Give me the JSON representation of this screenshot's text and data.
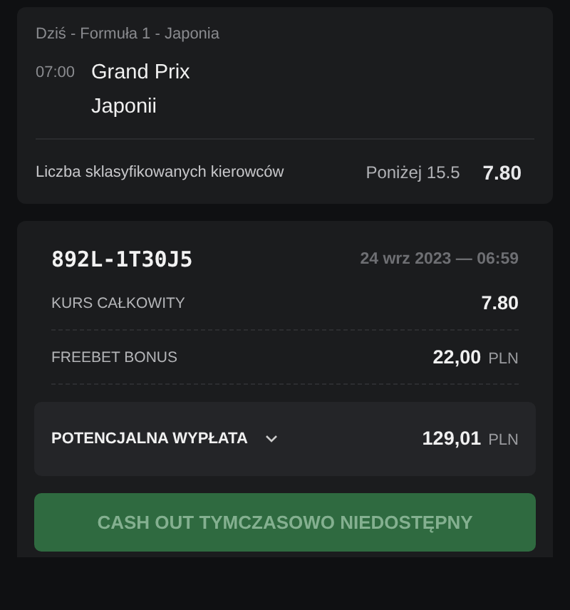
{
  "event": {
    "header": "Dziś - Formuła 1 - Japonia",
    "time": "07:00",
    "title_lines": [
      "Grand Prix",
      "Japonii"
    ],
    "market": "Liczba sklasyfikowanych kierowców",
    "selection": "Poniżej 15.5",
    "odds": "7.80"
  },
  "ticket": {
    "code": "892L-1T30J5",
    "date": "24 wrz 2023 — 06:59",
    "rows": [
      {
        "label": "KURS CAŁKOWITY",
        "value": "7.80"
      },
      {
        "label": "FREEBET BONUS",
        "value": "22,00",
        "currency": "PLN"
      }
    ],
    "payout": {
      "label": "POTENCJALNA WYPŁATA",
      "expanded": false,
      "value": "129,01",
      "currency": "PLN"
    },
    "cashout": {
      "label": "CASH OUT TYMCZASOWO NIEDOSTĘPNY",
      "disabled": true
    }
  }
}
